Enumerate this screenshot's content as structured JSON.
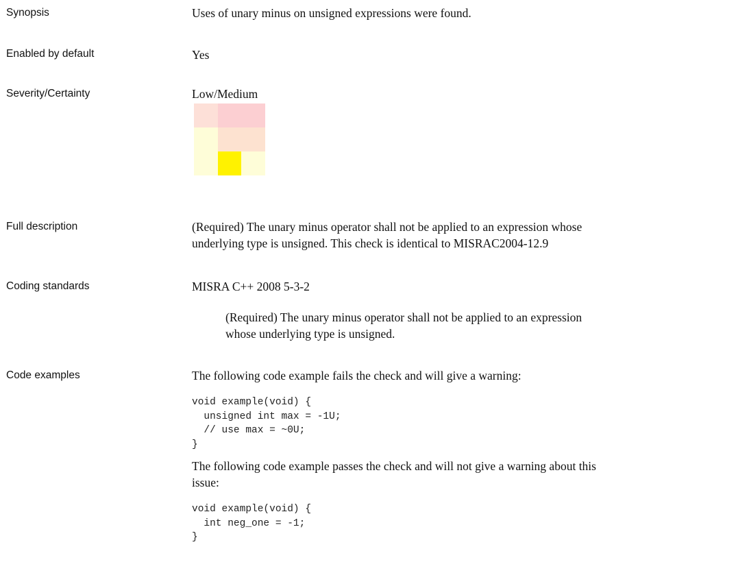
{
  "rows": {
    "synopsis": {
      "label": "Synopsis",
      "value": "Uses of unary minus on unsigned expressions were found."
    },
    "enabled": {
      "label": "Enabled by default",
      "value": "Yes"
    },
    "severity": {
      "label": "Severity/Certainty",
      "value": "Low/Medium",
      "matrix_colors": [
        [
          "#fde0d8",
          "#fccfd2",
          "#fccfd2"
        ],
        [
          "#fefdd8",
          "#fde2d0",
          "#fde2d0"
        ],
        [
          "#fefdd8",
          "#fff200",
          "#fefdd8"
        ]
      ]
    },
    "full_description": {
      "label": "Full description",
      "line1": "(Required) The unary minus operator shall not be applied to an expression whose",
      "line2": "underlying type is unsigned. This check is identical to MISRAC2004-12.9"
    },
    "coding_standards": {
      "label": "Coding standards",
      "standard": "MISRA C++ 2008 5-3-2",
      "detail_line1": "(Required) The unary minus operator shall not be applied to an expression",
      "detail_line2": "whose underlying type is unsigned."
    },
    "code_examples": {
      "label": "Code examples",
      "fail_intro": "The following code example fails the check and will give a warning:",
      "fail_code": "void example(void) {\n  unsigned int max = -1U;\n  // use max = ~0U;\n}",
      "pass_intro_line1": "The following code example passes the check and will not give a warning about this",
      "pass_intro_line2": "issue:",
      "pass_code": "void example(void) {\n  int neg_one = -1;\n}"
    }
  }
}
